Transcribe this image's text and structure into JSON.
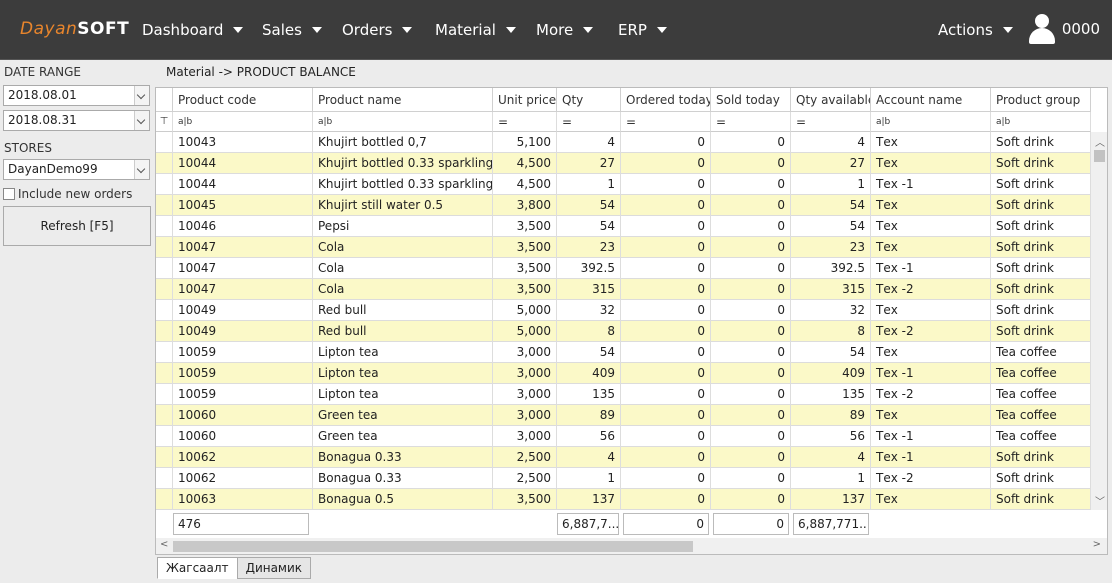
{
  "logo": {
    "part1": "Dayan",
    "part2": "SOFT"
  },
  "nav": [
    "Dashboard",
    "Sales",
    "Orders",
    "Material",
    "More",
    "ERP"
  ],
  "actions_label": "Actions",
  "user": {
    "name": "0000"
  },
  "sidebar": {
    "date_range_label": "DATE RANGE",
    "date_from": "2018.08.01",
    "date_to": "2018.08.31",
    "stores_label": "STORES",
    "store": "DayanDemo99",
    "include_new_orders": "Include new orders",
    "refresh": "Refresh [F5]"
  },
  "breadcrumb": "Material -> PRODUCT BALANCE",
  "columns": [
    "Product code",
    "Product name",
    "Unit price",
    "Qty",
    "Ordered today",
    "Sold today",
    "Qty available",
    "Account name",
    "Product group"
  ],
  "filter_tokens": {
    "text": "a|b",
    "num": "="
  },
  "rows": [
    [
      "10043",
      "Khujirt bottled 0,7",
      "5,100",
      "4",
      "0",
      "0",
      "4",
      "Тех",
      "Soft drink"
    ],
    [
      "10044",
      "Khujirt bottled 0.33 sparkling",
      "4,500",
      "27",
      "0",
      "0",
      "27",
      "Тех",
      "Soft drink"
    ],
    [
      "10044",
      "Khujirt bottled 0.33 sparkling",
      "4,500",
      "1",
      "0",
      "0",
      "1",
      "Тех -1",
      "Soft drink"
    ],
    [
      "10045",
      "Khujirt still water 0.5",
      "3,800",
      "54",
      "0",
      "0",
      "54",
      "Тех",
      "Soft drink"
    ],
    [
      "10046",
      "Pepsi",
      "3,500",
      "54",
      "0",
      "0",
      "54",
      "Тех",
      "Soft drink"
    ],
    [
      "10047",
      "Cola",
      "3,500",
      "23",
      "0",
      "0",
      "23",
      "Тех",
      "Soft drink"
    ],
    [
      "10047",
      "Cola",
      "3,500",
      "392.5",
      "0",
      "0",
      "392.5",
      "Тех -1",
      "Soft drink"
    ],
    [
      "10047",
      "Cola",
      "3,500",
      "315",
      "0",
      "0",
      "315",
      "Тех -2",
      "Soft drink"
    ],
    [
      "10049",
      "Red bull",
      "5,000",
      "32",
      "0",
      "0",
      "32",
      "Тех",
      "Soft drink"
    ],
    [
      "10049",
      "Red bull",
      "5,000",
      "8",
      "0",
      "0",
      "8",
      "Тех -2",
      "Soft drink"
    ],
    [
      "10059",
      "Lipton tea",
      "3,000",
      "54",
      "0",
      "0",
      "54",
      "Тех",
      "Tea coffee"
    ],
    [
      "10059",
      "Lipton tea",
      "3,000",
      "409",
      "0",
      "0",
      "409",
      "Тех -1",
      "Tea coffee"
    ],
    [
      "10059",
      "Lipton tea",
      "3,000",
      "135",
      "0",
      "0",
      "135",
      "Тех -2",
      "Tea coffee"
    ],
    [
      "10060",
      "Green tea",
      "3,000",
      "89",
      "0",
      "0",
      "89",
      "Тех",
      "Tea coffee"
    ],
    [
      "10060",
      "Green tea",
      "3,000",
      "56",
      "0",
      "0",
      "56",
      "Тех -1",
      "Tea coffee"
    ],
    [
      "10062",
      "Bonagua 0.33",
      "2,500",
      "4",
      "0",
      "0",
      "4",
      "Тех -1",
      "Soft drink"
    ],
    [
      "10062",
      "Bonagua 0.33",
      "2,500",
      "1",
      "0",
      "0",
      "1",
      "Тех -2",
      "Soft drink"
    ],
    [
      "10063",
      "Bonagua 0.5",
      "3,500",
      "137",
      "0",
      "0",
      "137",
      "Тех",
      "Soft drink"
    ]
  ],
  "footer": {
    "count": "476",
    "qty": "6,887,7...",
    "ordered": "0",
    "sold": "0",
    "available": "6,887,771...."
  },
  "tabs": [
    "Жагсаалт",
    "Динамик"
  ],
  "colors": {
    "topbar": "#3c3c3c",
    "accent": "#e8852c",
    "row_alt": "#fbf9c8"
  }
}
